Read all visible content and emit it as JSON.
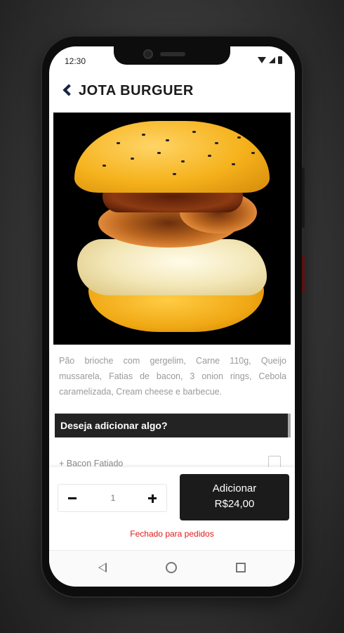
{
  "status": {
    "time": "12:30"
  },
  "header": {
    "title": "JOTA BURGUER"
  },
  "product": {
    "description": "Pão brioche com gergelim, Carne 110g, Queijo mussarela, Fatias de bacon, 3 onion rings, Cebola caramelizada, Cream cheese e barbecue."
  },
  "addons": {
    "section_title": "Deseja adicionar algo?",
    "items": [
      {
        "label": "+ Bacon Fatiado",
        "checked": false
      }
    ]
  },
  "order": {
    "quantity": "1",
    "add_label": "Adicionar",
    "price": "R$24,00",
    "closed_message": "Fechado para pedidos"
  },
  "icons": {
    "back": "chevron-left-icon",
    "minus": "minus-icon",
    "plus": "plus-icon",
    "nav_back": "triangle-back-icon",
    "nav_home": "circle-home-icon",
    "nav_recents": "square-recents-icon"
  },
  "colors": {
    "accent_dark": "#1b1b1b",
    "back_chevron": "#1a2346",
    "closed_red": "#e01b1b",
    "section_bar": "#232323"
  }
}
